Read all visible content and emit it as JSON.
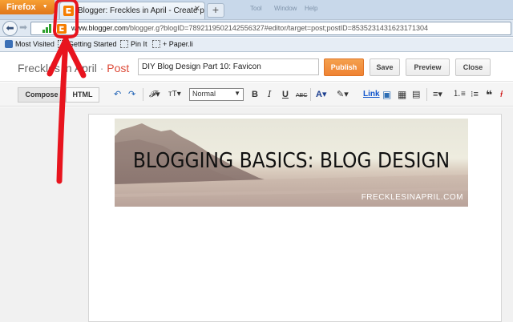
{
  "browser": {
    "app_button": "Firefox",
    "tab_title": "Blogger: Freckles in April - Create post",
    "new_tab_label": "+",
    "menu_ghosts": [
      "Tool",
      "Window",
      "Help"
    ],
    "url_domain": "www.blogger.com",
    "url_path": "/blogger.g?blogID=7892119502142556327#editor/target=post;postID=8535231431623171304",
    "bookmarks": [
      "Most Visited",
      "Getting Started",
      "Pin It",
      "+ Paper.li"
    ]
  },
  "editor": {
    "blog_name": "Freckles in April",
    "separator": "·",
    "post_label": "Post",
    "post_title": "DIY Blog Design Part 10: Favicon",
    "buttons": {
      "publish": "Publish",
      "save": "Save",
      "preview": "Preview",
      "close": "Close"
    },
    "modes": {
      "compose": "Compose",
      "html": "HTML"
    },
    "toolbar": {
      "format": "Normal",
      "link": "Link",
      "bold": "B",
      "italic": "I",
      "underline": "U",
      "strike": "ABC"
    }
  },
  "banner": {
    "title": "BLOGGING BASICS: BLOG DESIGN",
    "subtitle": "FRECKLESINAPRIL.COM"
  },
  "colors": {
    "blogger_orange": "#f57d00",
    "publish_orange": "#ef8333",
    "annotation_red": "#e8141e",
    "post_red": "#dd4b39"
  },
  "icons": [
    "blogger-icon",
    "back-arrow-icon",
    "forward-arrow-icon",
    "signal-icon",
    "bookmark-icon",
    "undo-icon",
    "redo-icon",
    "font-icon",
    "text-size-icon",
    "text-color-icon",
    "highlight-icon",
    "image-icon",
    "video-icon",
    "jump-break-icon",
    "align-icon",
    "numbered-list-icon",
    "bullet-list-icon",
    "quote-icon",
    "clear-format-icon",
    "red-arrow-icon"
  ]
}
